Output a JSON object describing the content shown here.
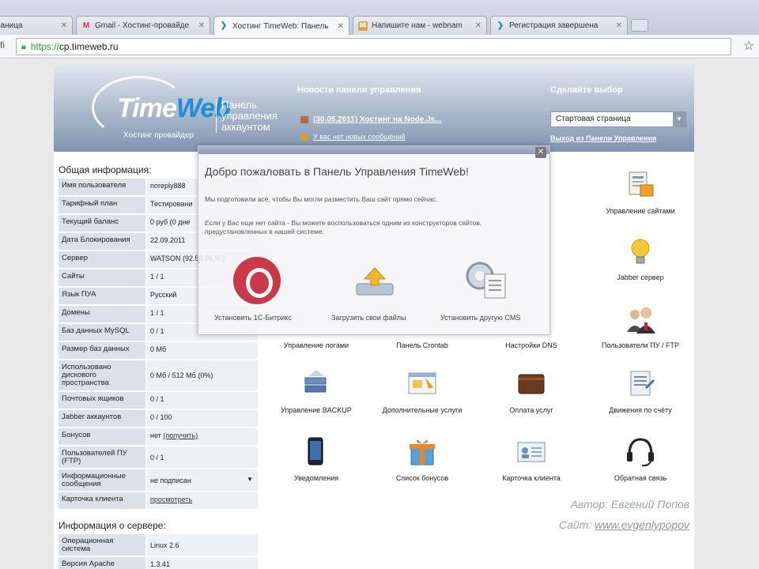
{
  "browser": {
    "tabs": [
      {
        "title": "раница",
        "favicon": "page-icon"
      },
      {
        "title": "Gmail - Хостинг-провайде",
        "favicon": "gmail-icon"
      },
      {
        "title": "Хостинг TimeWeb: Панель",
        "favicon": "timeweb-icon",
        "active": true
      },
      {
        "title": "Напишите нам - webnam",
        "favicon": "mail-icon"
      },
      {
        "title": "Регистрация завершена",
        "favicon": "timeweb-icon"
      }
    ],
    "url_scheme": "https://",
    "url_host": "cp.timeweb.ru"
  },
  "header": {
    "logo_time": "Time",
    "logo_web": "Web",
    "logo_sub": "Хостинг провайдер",
    "panel_title": "Панель управления аккаунтом",
    "news_heading": "Новости панели управления",
    "news_item": "(30.05.2011) Хостинг на Node.Js...",
    "news_messages": "У вас нет новых сообщений",
    "choose_heading": "Сделайте выбор",
    "select_value": "Стартовая страница",
    "exit_link": "Выход из Панели Управления"
  },
  "general": {
    "title": "Общая информация:",
    "rows": [
      {
        "label": "Имя пользователя",
        "value": "noreply888"
      },
      {
        "label": "Тарифный план",
        "value": "Тестировани"
      },
      {
        "label": "Текущий баланс",
        "value": "0 руб (0 дне"
      },
      {
        "label": "Дата Блокирования",
        "value": "22.09.2011"
      },
      {
        "label": "Сервер",
        "value": "WATSON (92.53.96.90)"
      },
      {
        "label": "Сайты",
        "value": "1 / 1"
      },
      {
        "label": "Язык ПУА",
        "value": "Русский"
      },
      {
        "label": "Домены",
        "value": "1 / 1"
      },
      {
        "label": "Баз данных MySQL",
        "value": "0 / 1"
      },
      {
        "label": "Размер баз данных",
        "value": "0 Мб"
      },
      {
        "label": "Использовано дискового пространства",
        "value": "0 Мб / 512 Мб (0%)"
      },
      {
        "label": "Почтовых ящиков",
        "value": "0 / 1"
      },
      {
        "label": "Jabber аккаунтов",
        "value": "0 / 100"
      },
      {
        "label": "Бонусов",
        "value": "нет",
        "link": "(получить)"
      },
      {
        "label": "Пользователей ПУ (FTP)",
        "value": "0 / 1"
      },
      {
        "label": "Информационные сообщения",
        "value": "не подписан"
      },
      {
        "label": "Карточка клиента",
        "link_only": "просмотреть"
      }
    ]
  },
  "server": {
    "title": "Информация о сервере:",
    "rows": [
      {
        "label": "Операционная система",
        "value": "Linux 2.6"
      },
      {
        "label": "Версия Apache",
        "value": "1.3.41"
      }
    ]
  },
  "grid": [
    {
      "label": "Управление сайтами",
      "icon": "sites-icon"
    },
    {
      "label": "Jabber сервер",
      "icon": "lightbulb-icon"
    },
    {
      "label": "Управление логами",
      "icon": "logs-icon"
    },
    {
      "label": "Панель Crontab",
      "icon": "crontab-icon"
    },
    {
      "label": "Настройки DNS",
      "icon": "dns-icon"
    },
    {
      "label": "Пользователи ПУ / FTP",
      "icon": "users-icon"
    },
    {
      "label": "Управление BACKUP",
      "icon": "backup-icon"
    },
    {
      "label": "Дополнительные услуги",
      "icon": "services-icon"
    },
    {
      "label": "Оплата услуг",
      "icon": "wallet-icon"
    },
    {
      "label": "Движения по счёту",
      "icon": "ledger-icon"
    },
    {
      "label": "Уведомления",
      "icon": "phone-icon"
    },
    {
      "label": "Список бонусов",
      "icon": "gift-icon"
    },
    {
      "label": "Карточка клиента",
      "icon": "card-icon"
    },
    {
      "label": "Обратная связь",
      "icon": "headset-icon"
    }
  ],
  "overlay": {
    "title": "Добро пожаловать в Панель Управления TimeWeb!",
    "text1": "Мы подготовили всё, чтобы Вы могли разместить Ваш сайт прямо сейчас.",
    "text2": "Если у Вас еще нет сайта - Вы можете воспользоваться одним из конструкторов сайтов, предустановленных в нашей системе.",
    "option_bitrix": "Установить 1С-Битрикс",
    "option_upload": "Загрузить свои файлы",
    "option_other": "Установить другую CMS"
  },
  "watermark": {
    "author": "Автор: Евгений Попов",
    "site_prefix": "Сайт:",
    "site": "www.evgenlypopov"
  },
  "colors": {
    "header_top": "#dfe6ef",
    "header_bottom": "#7f93af",
    "label_bg": "#d9e1ea",
    "value_bg": "#edf0f4",
    "logo_blue": "#1e8ed8",
    "bitrix_red": "#c83a4a"
  }
}
